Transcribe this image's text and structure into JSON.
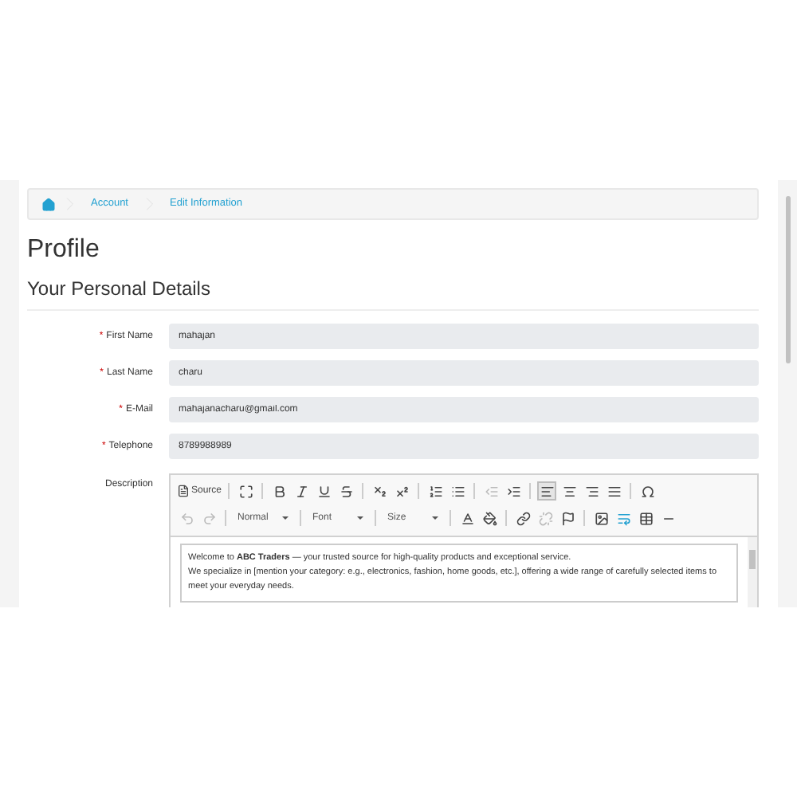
{
  "breadcrumb": [
    {
      "label": "Account"
    },
    {
      "label": "Edit Information"
    }
  ],
  "title": "Profile",
  "section": "Your Personal Details",
  "fields": [
    {
      "required_mark": "*",
      "label": "First Name",
      "value": "mahajan"
    },
    {
      "required_mark": "*",
      "label": "Last Name",
      "value": "charu"
    },
    {
      "required_mark": "*",
      "label": "E-Mail",
      "value": "mahajanacharu@gmail.com"
    },
    {
      "required_mark": "*",
      "label": "Telephone",
      "value": "8789988989"
    }
  ],
  "description": {
    "label": "Description",
    "toolbar": {
      "source": "Source",
      "format": "Normal",
      "font": "Font",
      "size": "Size",
      "alignment": [
        {
          "selected": true
        },
        {
          "selected": false
        },
        {
          "selected": false
        },
        {
          "selected": false
        }
      ]
    },
    "paragraphs": [
      "Welcome to **ABC Traders** — your trusted source for high-quality products and exceptional service.",
      "We specialize in [mention your category: e.g., electronics, fashion, home goods, etc.], offering a wide range of carefully selected items to meet your everyday needs."
    ]
  }
}
